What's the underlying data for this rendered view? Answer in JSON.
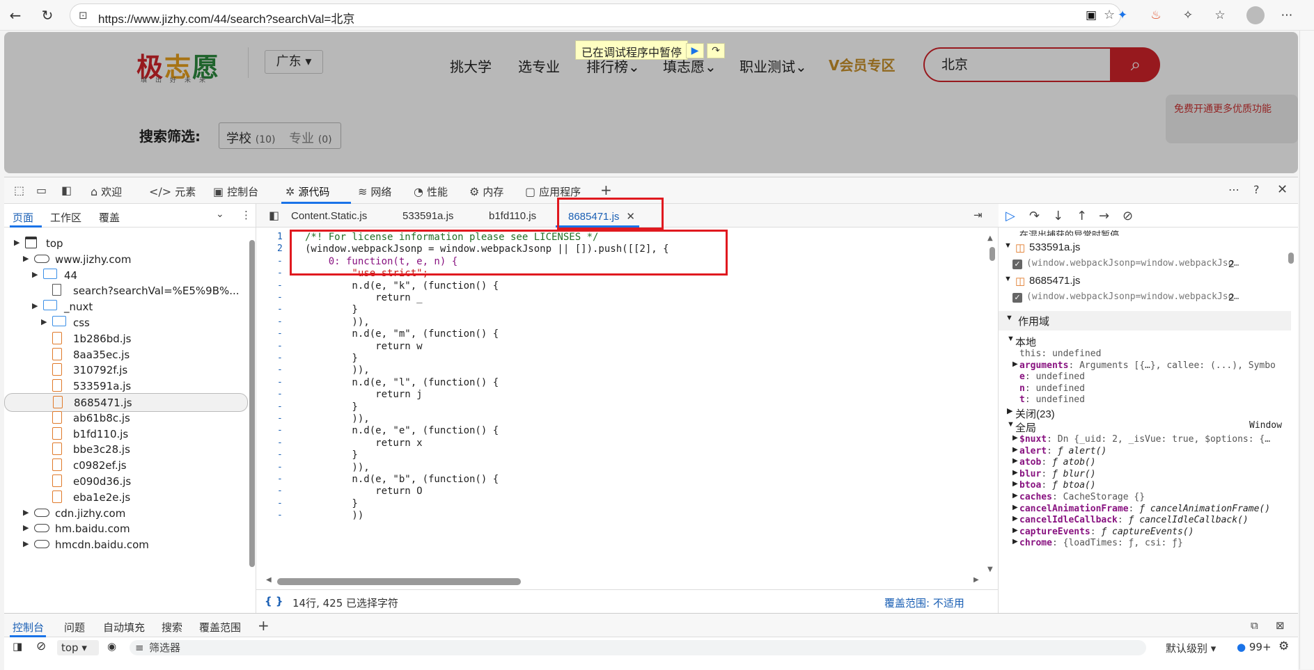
{
  "browser": {
    "url": "https://www.jizhy.com/44/search?searchVal=北京"
  },
  "site": {
    "logo_text": [
      "极",
      "志",
      "愿"
    ],
    "logo_sub": "填出好未来",
    "region": "广东",
    "nav": [
      "挑大学",
      "选专业",
      "排行榜",
      "填志愿",
      "职业测试"
    ],
    "vip": "V会员专区",
    "search_value": "北京",
    "filter_label": "搜索筛选:",
    "chips": [
      {
        "label": "学校",
        "count": "(10)"
      },
      {
        "label": "专业",
        "count": "(0)"
      }
    ],
    "paused_banner": "已在调试程序中暂停",
    "promo_text": "免费开通更多优质功能"
  },
  "devtools": {
    "tabs": [
      "欢迎",
      "元素",
      "控制台",
      "源代码",
      "网络",
      "性能",
      "内存",
      "应用程序"
    ],
    "left_tabs": [
      "页面",
      "工作区",
      "覆盖"
    ],
    "tree": [
      {
        "indent": 0,
        "type": "page",
        "label": "top",
        "twisty": "▼"
      },
      {
        "indent": 1,
        "type": "cloud",
        "label": "www.jizhy.com",
        "twisty": "▼"
      },
      {
        "indent": 2,
        "type": "folder",
        "label": "44",
        "twisty": "▶"
      },
      {
        "indent": 3,
        "type": "doc",
        "label": "search?searchVal=%E5%9B%...",
        "twisty": ""
      },
      {
        "indent": 2,
        "type": "folder",
        "label": "_nuxt",
        "twisty": "▼"
      },
      {
        "indent": 3,
        "type": "folder",
        "label": "css",
        "twisty": "▶"
      },
      {
        "indent": 3,
        "type": "file",
        "label": "1b286bd.js",
        "twisty": ""
      },
      {
        "indent": 3,
        "type": "file",
        "label": "8aa35ec.js",
        "twisty": ""
      },
      {
        "indent": 3,
        "type": "file",
        "label": "310792f.js",
        "twisty": ""
      },
      {
        "indent": 3,
        "type": "file",
        "label": "533591a.js",
        "twisty": ""
      },
      {
        "indent": 3,
        "type": "file",
        "label": "8685471.js",
        "twisty": "",
        "selected": true
      },
      {
        "indent": 3,
        "type": "file",
        "label": "ab61b8c.js",
        "twisty": ""
      },
      {
        "indent": 3,
        "type": "file",
        "label": "b1fd110.js",
        "twisty": ""
      },
      {
        "indent": 3,
        "type": "file",
        "label": "bbe3c28.js",
        "twisty": ""
      },
      {
        "indent": 3,
        "type": "file",
        "label": "c0982ef.js",
        "twisty": ""
      },
      {
        "indent": 3,
        "type": "file",
        "label": "e090d36.js",
        "twisty": ""
      },
      {
        "indent": 3,
        "type": "file",
        "label": "eba1e2e.js",
        "twisty": ""
      },
      {
        "indent": 1,
        "type": "cloud",
        "label": "cdn.jizhy.com",
        "twisty": "▶"
      },
      {
        "indent": 1,
        "type": "cloud",
        "label": "hm.baidu.com",
        "twisty": "▶"
      },
      {
        "indent": 1,
        "type": "cloud",
        "label": "hmcdn.baidu.com",
        "twisty": "▶"
      }
    ],
    "editor_tabs": [
      "Content.Static.js",
      "533591a.js",
      "b1fd110.js",
      "8685471.js"
    ],
    "code_lines": [
      {
        "ln": "1",
        "text": "/*! For license information please see LICENSES */",
        "cls": "cm"
      },
      {
        "ln": "2",
        "text": "(window.webpackJsonp = window.webpackJsonp || []).push([[2], {",
        "cls": ""
      },
      {
        "ln": "-",
        "text": "    0: function(t, e, n) {",
        "cls": "kw"
      },
      {
        "ln": "-",
        "text": "        \"use strict\";",
        "cls": "str"
      },
      {
        "ln": "-",
        "text": "        n.d(e, \"k\", (function() {",
        "cls": ""
      },
      {
        "ln": "-",
        "text": "            return _",
        "cls": ""
      },
      {
        "ln": "-",
        "text": "        }",
        "cls": ""
      },
      {
        "ln": "-",
        "text": "        )),",
        "cls": ""
      },
      {
        "ln": "-",
        "text": "        n.d(e, \"m\", (function() {",
        "cls": ""
      },
      {
        "ln": "-",
        "text": "            return w",
        "cls": ""
      },
      {
        "ln": "-",
        "text": "        }",
        "cls": ""
      },
      {
        "ln": "-",
        "text": "        )),",
        "cls": ""
      },
      {
        "ln": "-",
        "text": "        n.d(e, \"l\", (function() {",
        "cls": ""
      },
      {
        "ln": "-",
        "text": "            return j",
        "cls": ""
      },
      {
        "ln": "-",
        "text": "        }",
        "cls": ""
      },
      {
        "ln": "-",
        "text": "        )),",
        "cls": ""
      },
      {
        "ln": "-",
        "text": "        n.d(e, \"e\", (function() {",
        "cls": ""
      },
      {
        "ln": "-",
        "text": "            return x",
        "cls": ""
      },
      {
        "ln": "-",
        "text": "        }",
        "cls": ""
      },
      {
        "ln": "-",
        "text": "        )),",
        "cls": ""
      },
      {
        "ln": "-",
        "text": "        n.d(e, \"b\", (function() {",
        "cls": ""
      },
      {
        "ln": "-",
        "text": "            return O",
        "cls": ""
      },
      {
        "ln": "-",
        "text": "        }",
        "cls": ""
      },
      {
        "ln": "-",
        "text": "        ))",
        "cls": ""
      }
    ],
    "status_left": "14行, 425 已选择字符",
    "status_right": "覆盖范围: 不适用",
    "right": {
      "cut_header": "在混出捕获的异常时暂停",
      "breakpoints": [
        {
          "file": "533591a.js",
          "snippet": "(window.webpackJsonp=window.webpackJso…",
          "line": "2"
        },
        {
          "file": "8685471.js",
          "snippet": "(window.webpackJsonp=window.webpackJso…",
          "line": "2"
        }
      ],
      "scope_title": "作用域",
      "local_title": "本地",
      "local": [
        {
          "k": "this",
          "v": "undefined"
        },
        {
          "k": "arguments",
          "v": "Arguments [{…}, callee: (...), Symbo"
        },
        {
          "k": "e",
          "v": "undefined"
        },
        {
          "k": "n",
          "v": "undefined"
        },
        {
          "k": "t",
          "v": "undefined"
        }
      ],
      "closure": "关闭(23)",
      "global": "全局",
      "global_val": "Window",
      "globals": [
        {
          "k": "$nuxt",
          "v": "Dn {_uid: 2, _isVue: true, $options: {…"
        },
        {
          "k": "alert",
          "v": "ƒ alert()"
        },
        {
          "k": "atob",
          "v": "ƒ atob()"
        },
        {
          "k": "blur",
          "v": "ƒ blur()"
        },
        {
          "k": "btoa",
          "v": "ƒ btoa()"
        },
        {
          "k": "caches",
          "v": "CacheStorage {}"
        },
        {
          "k": "cancelAnimationFrame",
          "v": "ƒ cancelAnimationFrame()"
        },
        {
          "k": "cancelIdleCallback",
          "v": "ƒ cancelIdleCallback()"
        },
        {
          "k": "captureEvents",
          "v": "ƒ captureEvents()"
        },
        {
          "k": "chrome",
          "v": "{loadTimes: ƒ, csi: ƒ}"
        }
      ]
    },
    "drawer_tabs": [
      "控制台",
      "问题",
      "自动填充",
      "搜索",
      "覆盖范围"
    ],
    "console_context": "top",
    "console_filter": "筛选器",
    "log_level": "默认级别",
    "issue_count": "99+"
  }
}
